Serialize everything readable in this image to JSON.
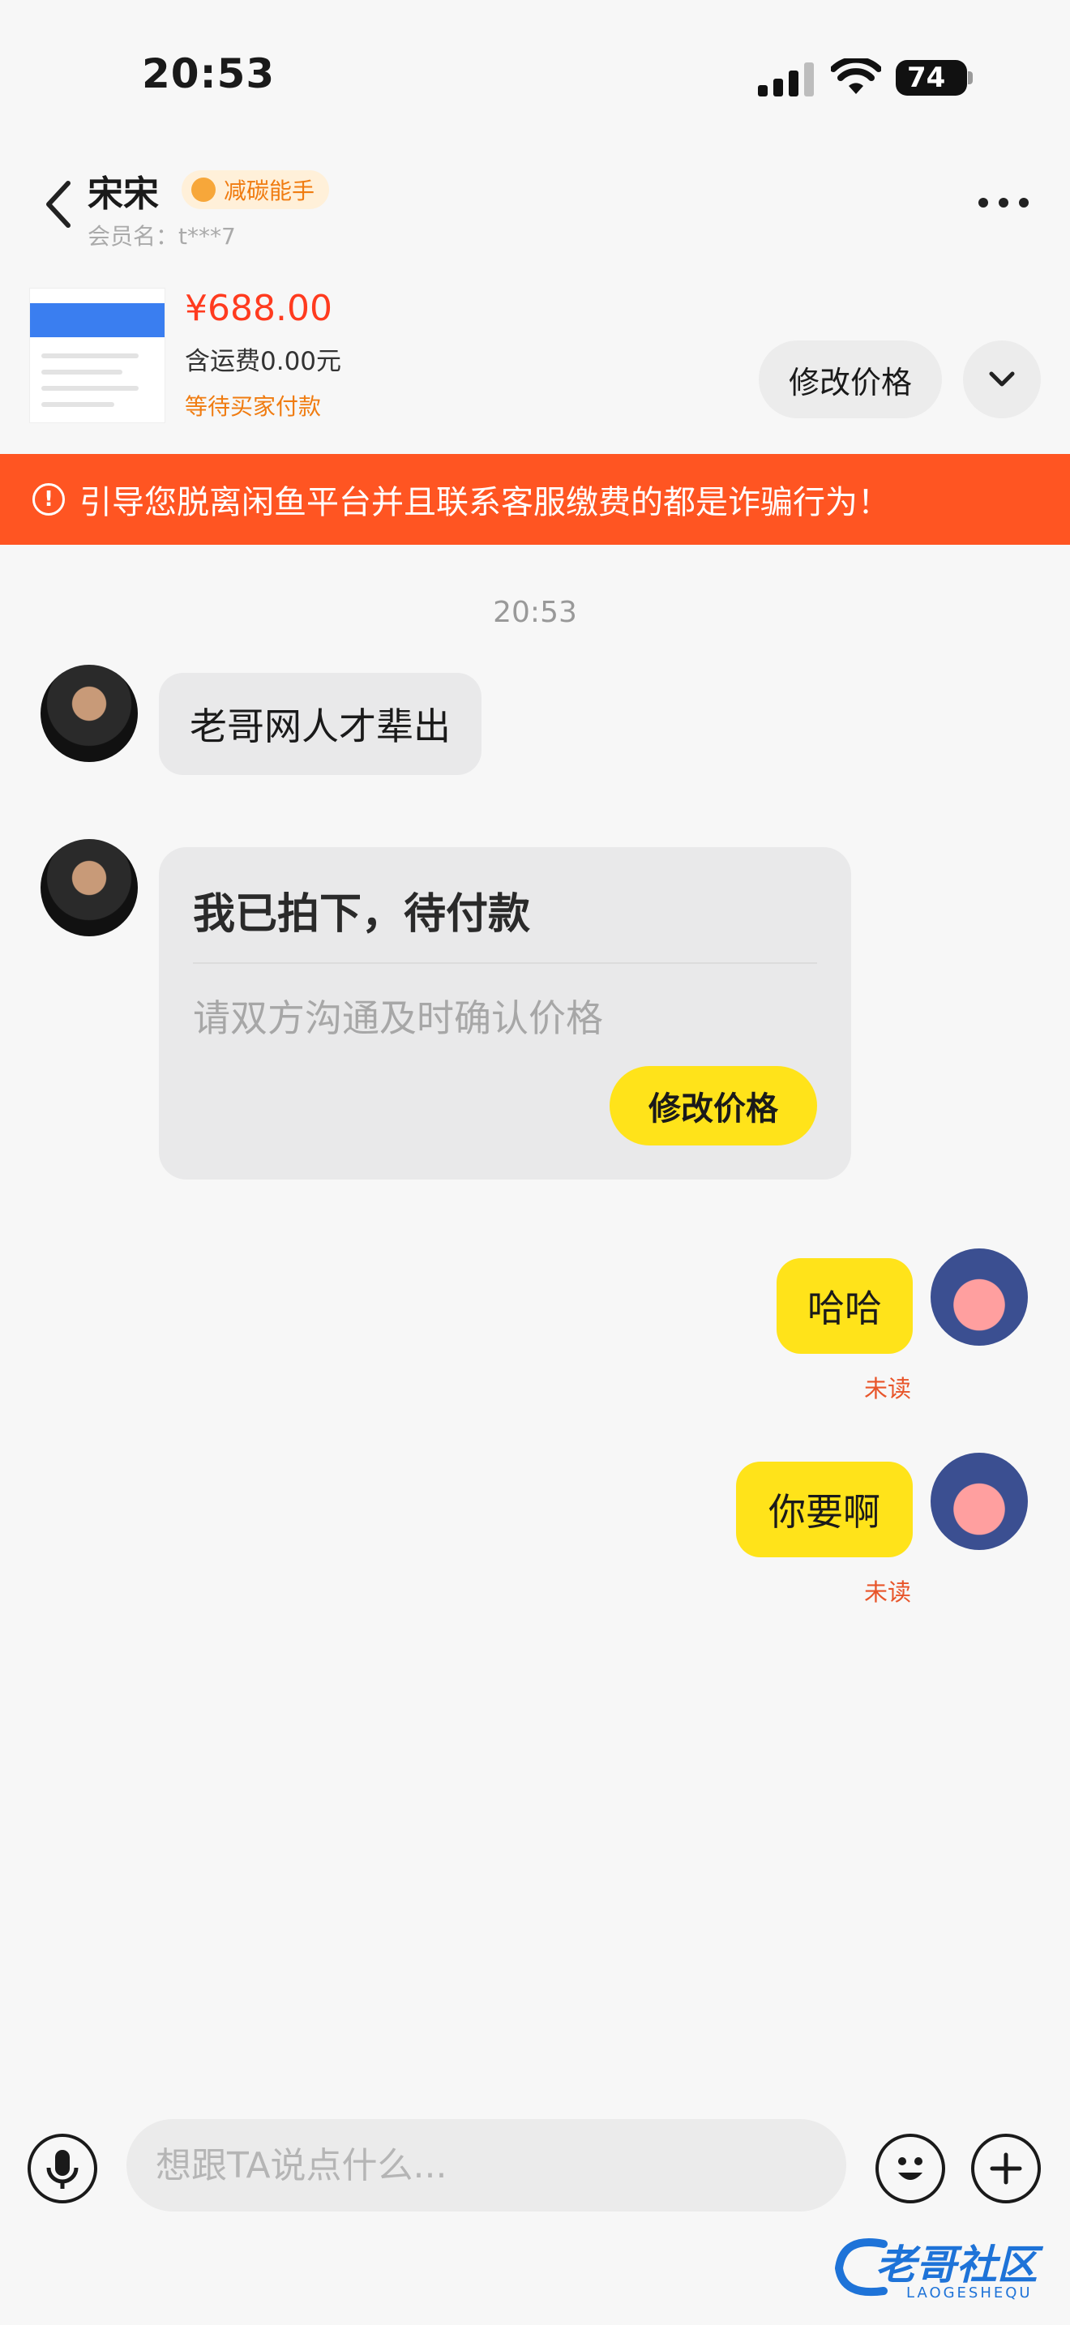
{
  "status_bar": {
    "time": "20:53",
    "battery": "74"
  },
  "header": {
    "name": "宋宋",
    "badge": "减碳能手",
    "member_label": "会员名：t***7"
  },
  "product": {
    "price": "¥688.00",
    "shipping": "含运费0.00元",
    "status": "等待买家付款",
    "edit_price_label": "修改价格"
  },
  "warning": {
    "text": "引导您脱离闲鱼平台并且联系客服缴费的都是诈骗行为！",
    "color": "#ff5522"
  },
  "chat": {
    "timestamp": "20:53",
    "messages": [
      {
        "from": "seller",
        "text": "老哥网人才辈出"
      },
      {
        "from": "me",
        "text": "哈哈",
        "status": "未读"
      },
      {
        "from": "me",
        "text": "你要啊",
        "status": "未读"
      }
    ],
    "order_card": {
      "title": "我已拍下，待付款",
      "hint": "请双方沟通及时确认价格",
      "button_label": "修改价格"
    }
  },
  "composer": {
    "placeholder": "想跟TA说点什么..."
  },
  "watermark": {
    "text": "老哥社区",
    "sub": "LAOGESHEQU"
  },
  "colors": {
    "accent_yellow": "#ffe31a",
    "price_red": "#ff3b1f",
    "status_orange": "#f07c11"
  }
}
